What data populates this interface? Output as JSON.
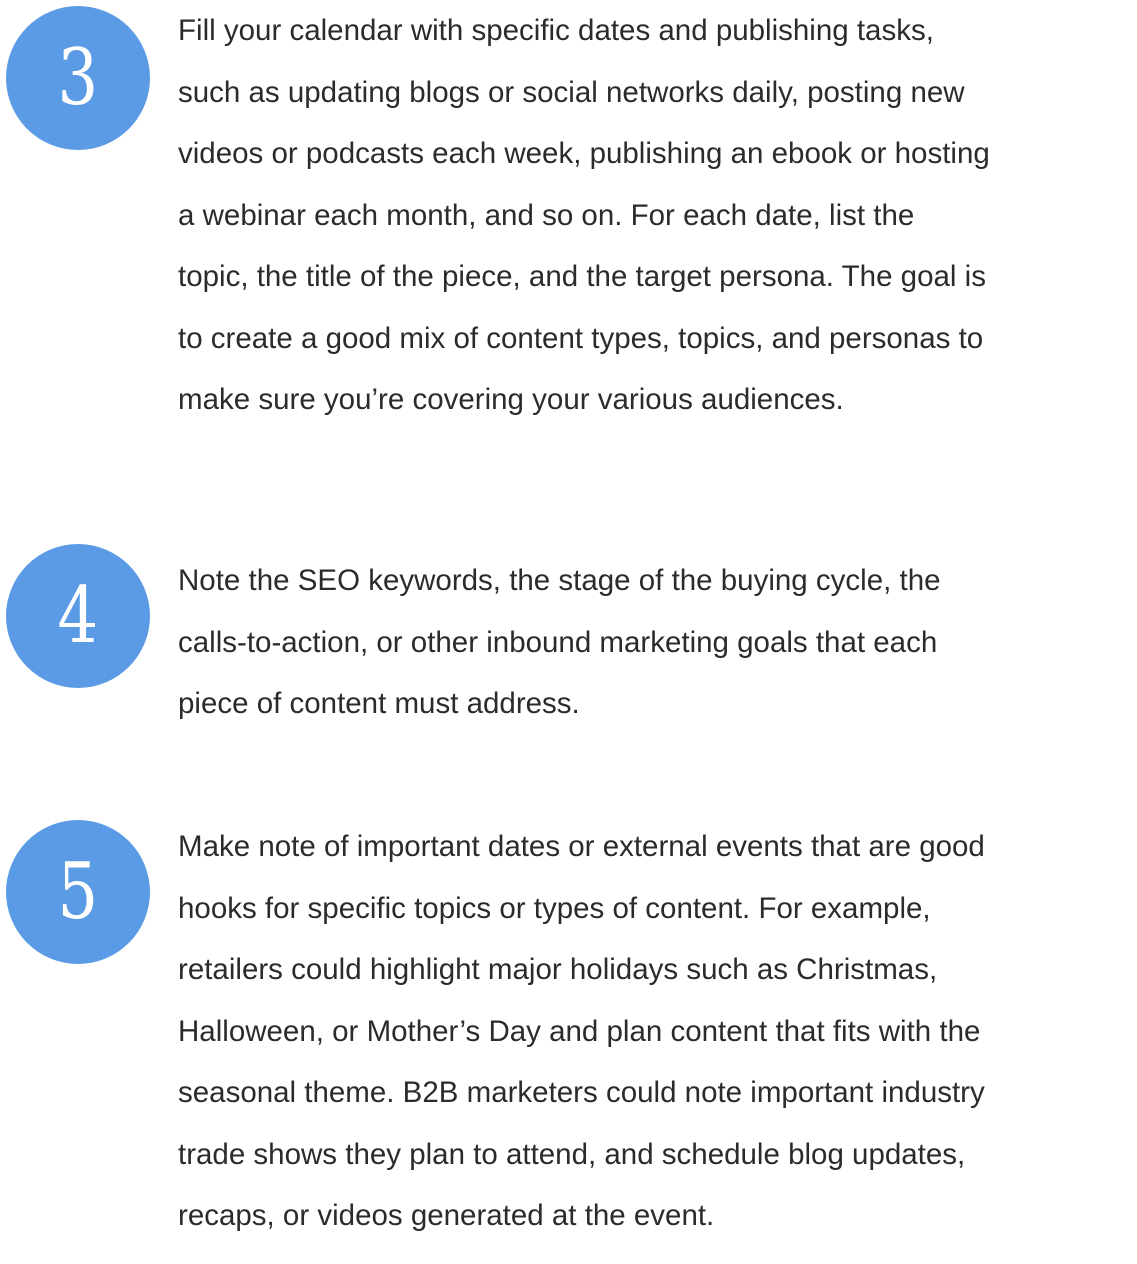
{
  "steps": [
    {
      "number": "3",
      "lines": [
        "Fill your calendar with specific dates and publishing tasks,",
        "such as updating blogs or social networks daily, posting new",
        "videos or podcasts each week, publishing an ebook or hosting",
        "a webinar each month, and so on. For each date, list the",
        "topic, the title of the piece, and the target persona. The goal is",
        "to create a good mix of content types, topics, and personas to",
        "make sure you’re covering your various audiences."
      ]
    },
    {
      "number": "4",
      "lines": [
        "Note the SEO keywords, the stage of the buying cycle, the",
        "calls-to-action, or other inbound marketing goals that each",
        "piece of content must address."
      ]
    },
    {
      "number": "5",
      "lines": [
        "Make note of important dates or external events that are good",
        "hooks for specific topics or types of content. For example,",
        "retailers could highlight major holidays such as Christmas,",
        "Halloween, or Mother’s Day and plan content that fits with the",
        "seasonal theme. B2B marketers could note important industry",
        "trade shows they plan to attend, and schedule blog updates,",
        "recaps, or videos generated at the event."
      ]
    }
  ],
  "colors": {
    "badge": "#5b9be6",
    "text": "#2b2b2b"
  }
}
